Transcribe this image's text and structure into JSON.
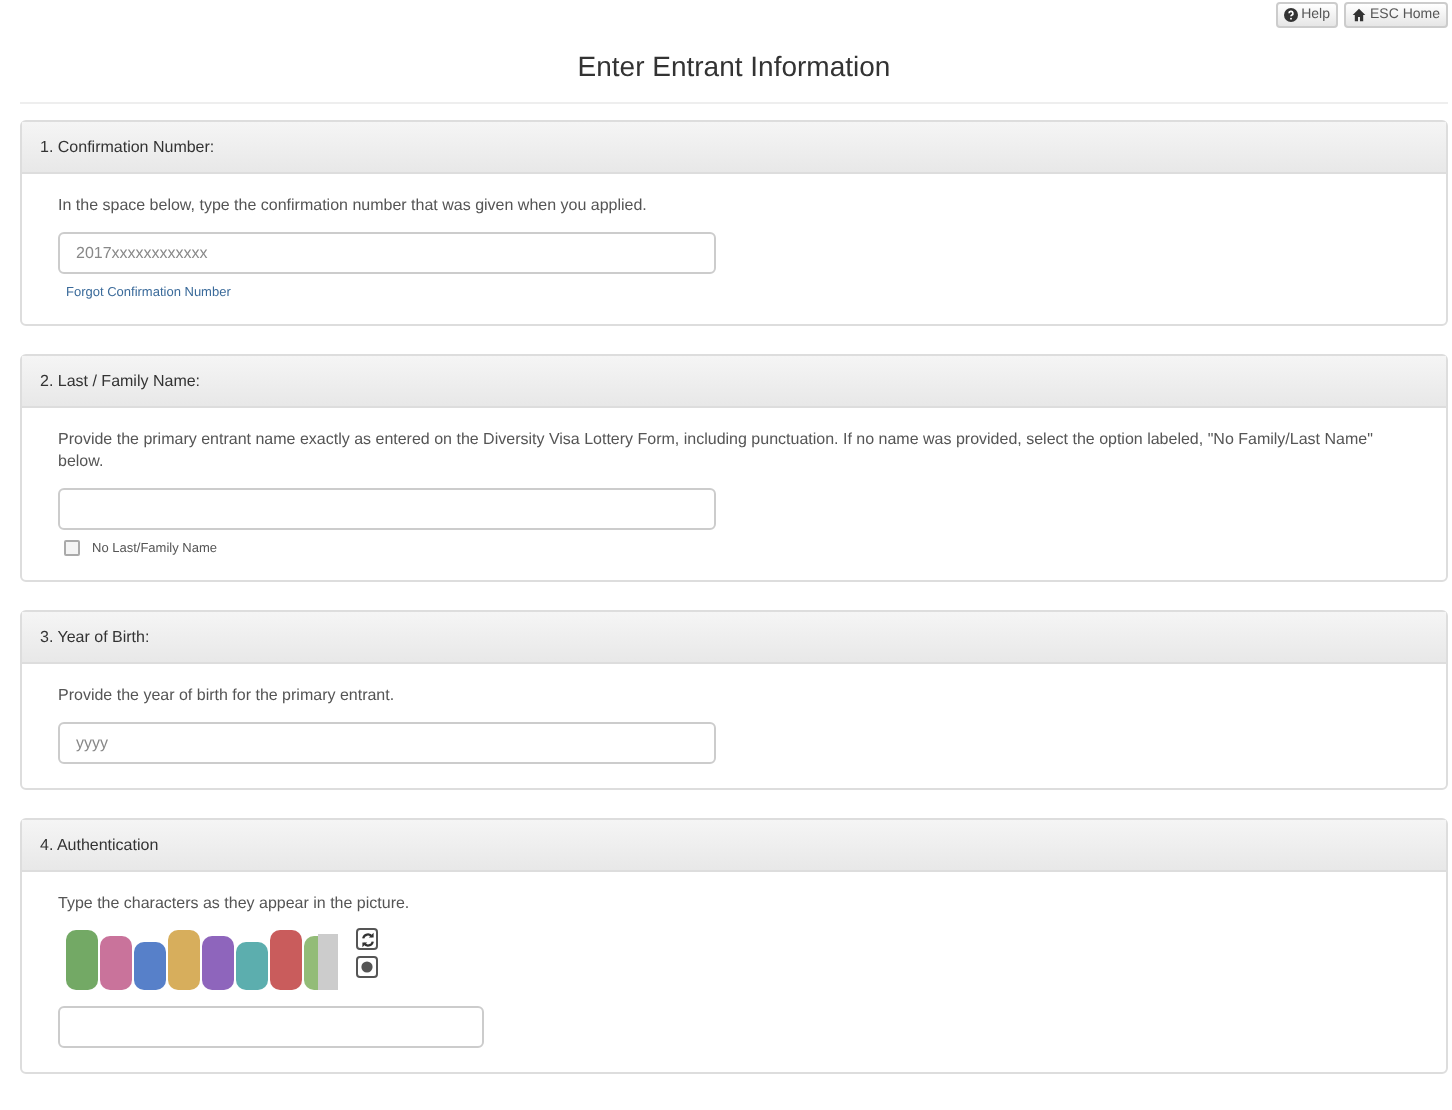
{
  "header_buttons": [
    {
      "label": "Help",
      "kind": "help"
    },
    {
      "label": "ESC Home",
      "kind": "home"
    }
  ],
  "title": "Enter Entrant Information",
  "sections": [
    {
      "kind": "text",
      "title": "1. Confirmation Number:",
      "instructions": "In the space below, type the confirmation number that was given when you applied.",
      "field": {
        "placeholder": "2017xxxxxxxxxxxx"
      },
      "link": "Forgot Confirmation Number"
    },
    {
      "kind": "text",
      "title": "2. Last / Family Name:",
      "instructions": "Provide the primary entrant name exactly as entered on the Diversity Visa Lottery Form, including punctuation. If no name was provided, select the option labeled, \"No Family/Last Name\" below.",
      "checkbox": {
        "label": "No Last/Family Name",
        "checked": false
      }
    },
    {
      "kind": "text",
      "title": "3. Year of Birth:",
      "instructions": "Provide the year of birth for the primary entrant.",
      "field": {
        "placeholder": "yyyy"
      }
    },
    {
      "kind": "captcha",
      "title": "4. Authentication",
      "instructions": "Type the characters as they appear in the picture."
    }
  ]
}
